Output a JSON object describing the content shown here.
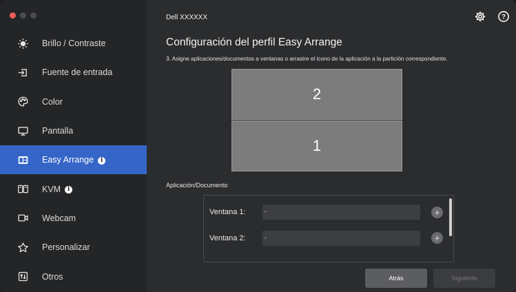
{
  "window": {
    "title": "Dell XXXXXX"
  },
  "sidebar": {
    "items": [
      {
        "label": "Brillo / Contraste",
        "icon": "brightness-icon"
      },
      {
        "label": "Fuente de entrada",
        "icon": "input-source-icon"
      },
      {
        "label": "Color",
        "icon": "palette-icon"
      },
      {
        "label": "Pantalla",
        "icon": "monitor-icon"
      },
      {
        "label": "Easy Arrange",
        "icon": "easy-arrange-icon",
        "active": true
      },
      {
        "label": "KVM",
        "icon": "kvm-icon"
      },
      {
        "label": "Webcam",
        "icon": "webcam-icon"
      },
      {
        "label": "Personalizar",
        "icon": "star-icon"
      },
      {
        "label": "Otros",
        "icon": "others-icon"
      }
    ]
  },
  "header": {
    "settings_icon": "gear-icon",
    "help_icon": "help-icon",
    "help_glyph": "?"
  },
  "main": {
    "title": "Configuración del perfil Easy Arrange",
    "instruction": "3. Asigne aplicaciones/documentos a ventanas o arrastre el icono de la aplicación a la partición correspondiente.",
    "layout_preview": {
      "top_pane": "2",
      "bottom_pane": "1"
    },
    "section_label": "Aplicación/Documento",
    "windows": [
      {
        "label": "Ventana 1:",
        "value": "-"
      },
      {
        "label": "Ventana 2:",
        "value": "-"
      }
    ],
    "add_glyph": "+",
    "buttons": {
      "back": "Atrás",
      "next": "Siguiente"
    }
  },
  "colors": {
    "accent": "#3565c7",
    "background": "#2b2c2e",
    "sidebar": "#242527"
  }
}
